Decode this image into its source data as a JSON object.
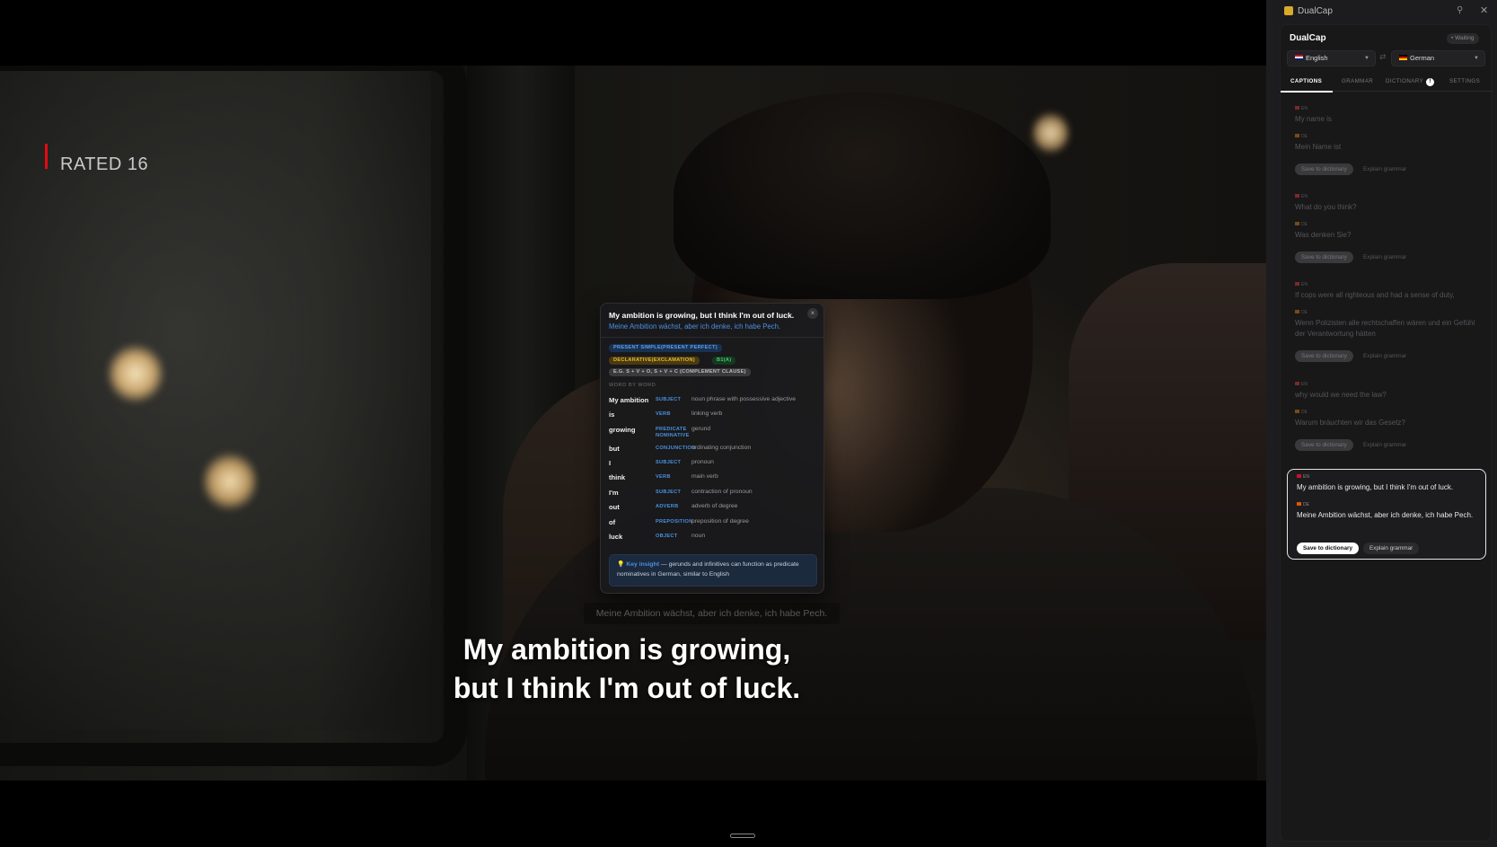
{
  "player": {
    "rating": "RATED 16",
    "subtitle_line1": "My ambition is growing,",
    "subtitle_line2": "but I think I'm out of luck.",
    "subtitle_secondary": "Meine Ambition wächst, aber ich denke, ich habe Pech."
  },
  "popup": {
    "title": "My ambition is growing, but I think I'm out of luck.",
    "translation": "Meine Ambition wächst, aber ich denke, ich habe Pech.",
    "close": "×",
    "tags": [
      "PRESENT SIMPLE(PRESENT PERFECT)",
      "DECLARATIVE(EXCLAMATION)",
      "B1(A)",
      "E.G. S + V + O, S + V + C (COMPLEMENT CLAUSE)"
    ],
    "word_by_word_label": "WORD BY WORD",
    "words": [
      {
        "word": "My ambition",
        "role": "SUBJECT",
        "desc": "noun phrase with possessive adjective"
      },
      {
        "word": "is",
        "role": "VERB",
        "desc": "linking verb"
      },
      {
        "word": "growing",
        "role": "PREDICATE NOMINATIVE",
        "desc": "gerund"
      },
      {
        "word": "but",
        "role": "CONJUNCTION",
        "desc": "ordinating conjunction"
      },
      {
        "word": "I",
        "role": "SUBJECT",
        "desc": "pronoun"
      },
      {
        "word": "think",
        "role": "VERB",
        "desc": "main verb"
      },
      {
        "word": "I'm",
        "role": "SUBJECT",
        "desc": "contraction of pronoun"
      },
      {
        "word": "out",
        "role": "ADVERB",
        "desc": "adverb of degree"
      },
      {
        "word": "of",
        "role": "PREPOSITION",
        "desc": "preposition of degree"
      },
      {
        "word": "luck",
        "role": "OBJECT",
        "desc": "noun"
      }
    ],
    "insight_label": "Key insight",
    "insight_text": " — gerunds and infinitives can function as predicate nominatives in German, similar to English"
  },
  "sidebar": {
    "window_title": "DualCap",
    "app_title": "DualCap",
    "status": "• Waiting",
    "lang_from": "English",
    "lang_to": "German",
    "swap": "⇄",
    "tabs": [
      "CAPTIONS",
      "GRAMMAR",
      "DICTIONARY",
      "SETTINGS"
    ],
    "dictionary_badge": "!",
    "en_code": "EN",
    "de_code": "DE",
    "save_label": "Save to dictionary",
    "explain_label": "Explain grammar",
    "captions": [
      {
        "en": "My name is",
        "de": "Mein Name ist"
      },
      {
        "en": "What do you think?",
        "de": "Was denken Sie?"
      },
      {
        "en": "If cops were all righteous and had a sense of duty,",
        "de": "Wenn Polizisten alle rechtschaffen wären und ein Gefühl der Verantwortung hätten"
      },
      {
        "en": "why would we need the law?",
        "de": "Warum bräuchten wir das Gesetz?"
      }
    ],
    "active_caption": {
      "en": "My ambition is growing, but I think I'm out of luck.",
      "de": "Meine Ambition wächst, aber ich denke, ich habe Pech."
    }
  },
  "colors": {
    "accent": "#4a90e2",
    "rating_red": "#e50914",
    "logo": "#d9a92a"
  }
}
